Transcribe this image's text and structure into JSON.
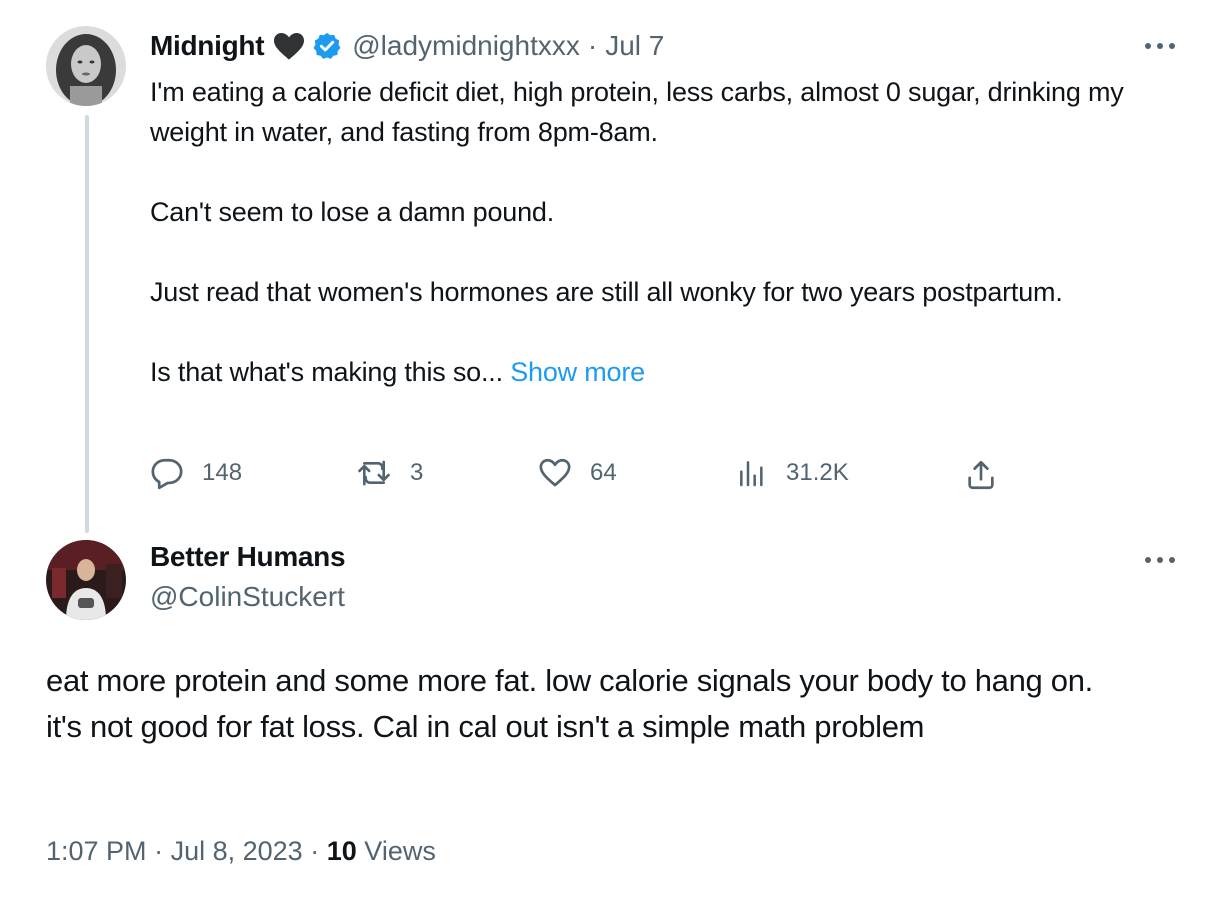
{
  "original": {
    "author_name": "Midnight",
    "handle": "@ladymidnightxxx",
    "separator": "·",
    "date": "Jul 7",
    "paragraphs": [
      "I'm eating a calorie deficit diet, high protein, less carbs, almost 0 sugar, drinking my weight in water, and fasting from 8pm-8am.",
      "Can't seem to lose a damn pound.",
      "Just read that women's hormones are still all wonky for two years postpartum."
    ],
    "truncated_text": "Is that what's making this so...",
    "show_more_label": "Show more",
    "stats": {
      "replies": "148",
      "reposts": "3",
      "likes": "64",
      "views": "31.2K"
    }
  },
  "reply": {
    "author_name": "Better Humans",
    "handle": "@ColinStuckert",
    "text": "eat more protein and some more fat. low calorie signals your body to hang on. it's not good for fat loss. Cal in cal out isn't a simple math problem",
    "time": "1:07 PM",
    "separator": "·",
    "date": "Jul 8, 2023",
    "view_count": "10",
    "views_label": "Views"
  },
  "icons": {
    "verified": "verified-badge-icon",
    "heart": "black-heart-icon",
    "more": "more-icon",
    "reply": "reply-icon",
    "repost": "repost-icon",
    "like": "like-icon",
    "views": "views-icon",
    "share": "share-icon"
  },
  "colors": {
    "accent": "#1d9bf0",
    "secondary_text": "#536471",
    "primary_text": "#0f1419",
    "thread_line": "#cfd9de"
  }
}
